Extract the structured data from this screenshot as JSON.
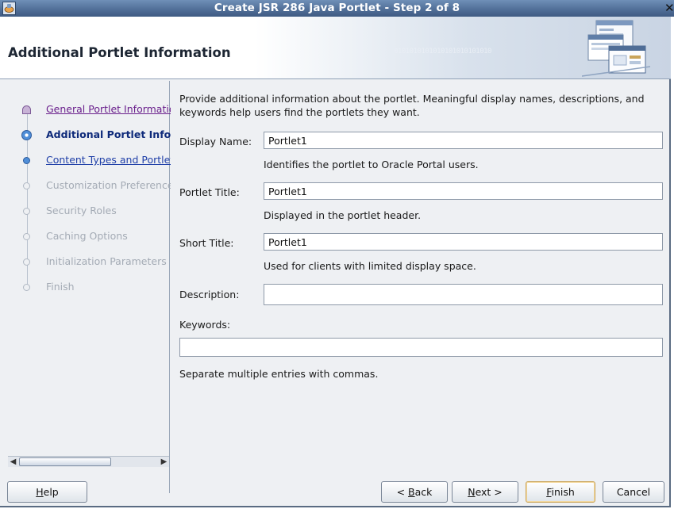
{
  "window": {
    "title": "Create JSR 286 Java Portlet - Step 2 of 8",
    "close_glyph": "✕"
  },
  "header": {
    "heading": "Additional Portlet Information",
    "decor_binary": "0101010101010101010101010"
  },
  "steps": [
    {
      "label": "General Portlet Information",
      "state": "visited"
    },
    {
      "label": "Additional Portlet Information",
      "state": "active"
    },
    {
      "label": "Content Types and Portlet Modes",
      "state": "link"
    },
    {
      "label": "Customization Preferences",
      "state": "disabled"
    },
    {
      "label": "Security Roles",
      "state": "disabled"
    },
    {
      "label": "Caching Options",
      "state": "disabled"
    },
    {
      "label": "Initialization Parameters",
      "state": "disabled"
    },
    {
      "label": "Finish",
      "state": "disabled"
    }
  ],
  "form": {
    "intro": "Provide additional information about the portlet. Meaningful display names, descriptions, and keywords help users find the portlets they want.",
    "display_name": {
      "label": "Display Name:",
      "value": "Portlet1",
      "hint": "Identifies the portlet to Oracle Portal users."
    },
    "portlet_title": {
      "label": "Portlet Title:",
      "value": "Portlet1",
      "hint": "Displayed in the portlet header."
    },
    "short_title": {
      "label": "Short Title:",
      "value": "Portlet1",
      "hint": "Used for clients with limited display space."
    },
    "description": {
      "label": "Description:",
      "value": ""
    },
    "keywords": {
      "label": "Keywords:",
      "value": "",
      "hint": "Separate multiple entries with commas."
    }
  },
  "buttons": {
    "help": {
      "pre": "",
      "mnemonic": "H",
      "post": "elp"
    },
    "back": {
      "pre": "< ",
      "mnemonic": "B",
      "post": "ack"
    },
    "next": {
      "pre": "",
      "mnemonic": "N",
      "post": "ext >"
    },
    "finish": {
      "pre": "",
      "mnemonic": "F",
      "post": "inish"
    },
    "cancel": {
      "pre": "Cancel",
      "mnemonic": "",
      "post": ""
    }
  },
  "colors": {
    "titlebar": "#4f6d96",
    "visited_link": "#6a1f8c",
    "active_step": "#0e2a7a",
    "link": "#1f3fa8",
    "disabled": "#a4abb5"
  }
}
